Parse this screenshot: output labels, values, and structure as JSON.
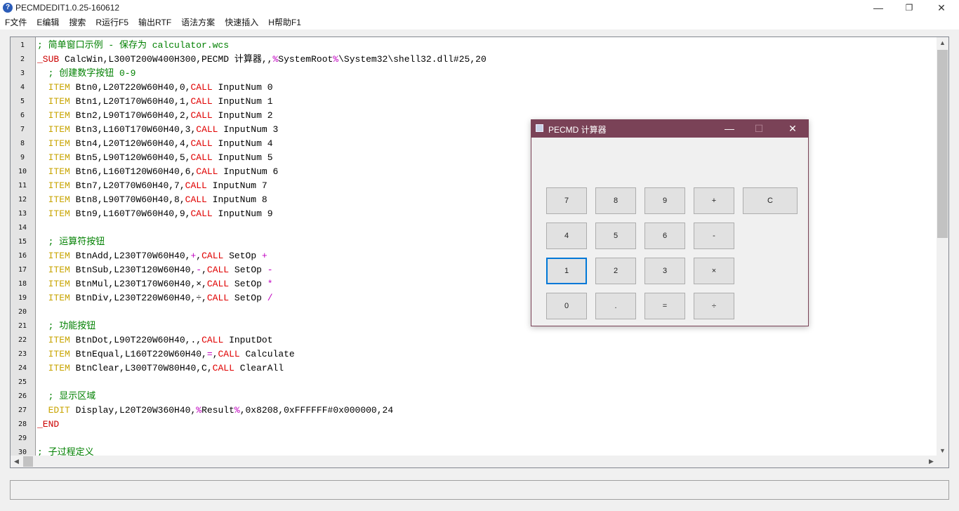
{
  "window": {
    "title": "PECMDEDIT1.0.25-160612",
    "minimize": "—",
    "restore": "❐",
    "close": "✕"
  },
  "menu": [
    "F文件",
    "E编辑",
    "搜索",
    "R运行F5",
    "输出RTF",
    "语法方案",
    "快速插入",
    "H帮助F1"
  ],
  "editor": {
    "line_numbers": [
      "1",
      "2",
      "3",
      "4",
      "5",
      "6",
      "7",
      "8",
      "9",
      "10",
      "11",
      "12",
      "13",
      "14",
      "15",
      "16",
      "17",
      "18",
      "19",
      "20",
      "21",
      "22",
      "23",
      "24",
      "25",
      "26",
      "27",
      "28",
      "29",
      "30"
    ],
    "lines": [
      [
        {
          "t": "; 简单窗口示例 - 保存为 calculator.wcs",
          "c": "cmt"
        }
      ],
      [
        {
          "t": "_SUB",
          "c": "sub"
        },
        {
          "t": " CalcWin,L300T200W400H300,PECMD 计算器,,"
        },
        {
          "t": "%",
          "c": "op"
        },
        {
          "t": "SystemRoot"
        },
        {
          "t": "%",
          "c": "op"
        },
        {
          "t": "\\System32\\shell32.dll#25,20"
        }
      ],
      [
        {
          "t": "  ; 创建数字按钮 0-9",
          "c": "cmt"
        }
      ],
      [
        {
          "t": "  "
        },
        {
          "t": "ITEM",
          "c": "kw"
        },
        {
          "t": " Btn0,L20T220W60H40,0,"
        },
        {
          "t": "CALL",
          "c": "call"
        },
        {
          "t": " InputNum 0"
        }
      ],
      [
        {
          "t": "  "
        },
        {
          "t": "ITEM",
          "c": "kw"
        },
        {
          "t": " Btn1,L20T170W60H40,1,"
        },
        {
          "t": "CALL",
          "c": "call"
        },
        {
          "t": " InputNum 1"
        }
      ],
      [
        {
          "t": "  "
        },
        {
          "t": "ITEM",
          "c": "kw"
        },
        {
          "t": " Btn2,L90T170W60H40,2,"
        },
        {
          "t": "CALL",
          "c": "call"
        },
        {
          "t": " InputNum 2"
        }
      ],
      [
        {
          "t": "  "
        },
        {
          "t": "ITEM",
          "c": "kw"
        },
        {
          "t": " Btn3,L160T170W60H40,3,"
        },
        {
          "t": "CALL",
          "c": "call"
        },
        {
          "t": " InputNum 3"
        }
      ],
      [
        {
          "t": "  "
        },
        {
          "t": "ITEM",
          "c": "kw"
        },
        {
          "t": " Btn4,L20T120W60H40,4,"
        },
        {
          "t": "CALL",
          "c": "call"
        },
        {
          "t": " InputNum 4"
        }
      ],
      [
        {
          "t": "  "
        },
        {
          "t": "ITEM",
          "c": "kw"
        },
        {
          "t": " Btn5,L90T120W60H40,5,"
        },
        {
          "t": "CALL",
          "c": "call"
        },
        {
          "t": " InputNum 5"
        }
      ],
      [
        {
          "t": "  "
        },
        {
          "t": "ITEM",
          "c": "kw"
        },
        {
          "t": " Btn6,L160T120W60H40,6,"
        },
        {
          "t": "CALL",
          "c": "call"
        },
        {
          "t": " InputNum 6"
        }
      ],
      [
        {
          "t": "  "
        },
        {
          "t": "ITEM",
          "c": "kw"
        },
        {
          "t": " Btn7,L20T70W60H40,7,"
        },
        {
          "t": "CALL",
          "c": "call"
        },
        {
          "t": " InputNum 7"
        }
      ],
      [
        {
          "t": "  "
        },
        {
          "t": "ITEM",
          "c": "kw"
        },
        {
          "t": " Btn8,L90T70W60H40,8,"
        },
        {
          "t": "CALL",
          "c": "call"
        },
        {
          "t": " InputNum 8"
        }
      ],
      [
        {
          "t": "  "
        },
        {
          "t": "ITEM",
          "c": "kw"
        },
        {
          "t": " Btn9,L160T70W60H40,9,"
        },
        {
          "t": "CALL",
          "c": "call"
        },
        {
          "t": " InputNum 9"
        }
      ],
      [],
      [
        {
          "t": "  ; 运算符按钮",
          "c": "cmt"
        }
      ],
      [
        {
          "t": "  "
        },
        {
          "t": "ITEM",
          "c": "kw"
        },
        {
          "t": " BtnAdd,L230T70W60H40,"
        },
        {
          "t": "+",
          "c": "op"
        },
        {
          "t": ","
        },
        {
          "t": "CALL",
          "c": "call"
        },
        {
          "t": " SetOp "
        },
        {
          "t": "+",
          "c": "op"
        }
      ],
      [
        {
          "t": "  "
        },
        {
          "t": "ITEM",
          "c": "kw"
        },
        {
          "t": " BtnSub,L230T120W60H40,"
        },
        {
          "t": "-",
          "c": "op"
        },
        {
          "t": ","
        },
        {
          "t": "CALL",
          "c": "call"
        },
        {
          "t": " SetOp "
        },
        {
          "t": "-",
          "c": "op"
        }
      ],
      [
        {
          "t": "  "
        },
        {
          "t": "ITEM",
          "c": "kw"
        },
        {
          "t": " BtnMul,L230T170W60H40,×,"
        },
        {
          "t": "CALL",
          "c": "call"
        },
        {
          "t": " SetOp "
        },
        {
          "t": "*",
          "c": "op"
        }
      ],
      [
        {
          "t": "  "
        },
        {
          "t": "ITEM",
          "c": "kw"
        },
        {
          "t": " BtnDiv,L230T220W60H40,÷,"
        },
        {
          "t": "CALL",
          "c": "call"
        },
        {
          "t": " SetOp "
        },
        {
          "t": "/",
          "c": "op"
        }
      ],
      [],
      [
        {
          "t": "  ; 功能按钮",
          "c": "cmt"
        }
      ],
      [
        {
          "t": "  "
        },
        {
          "t": "ITEM",
          "c": "kw"
        },
        {
          "t": " BtnDot,L90T220W60H40,.,"
        },
        {
          "t": "CALL",
          "c": "call"
        },
        {
          "t": " InputDot"
        }
      ],
      [
        {
          "t": "  "
        },
        {
          "t": "ITEM",
          "c": "kw"
        },
        {
          "t": " BtnEqual,L160T220W60H40,"
        },
        {
          "t": "=",
          "c": "op"
        },
        {
          "t": ","
        },
        {
          "t": "CALL",
          "c": "call"
        },
        {
          "t": " Calculate"
        }
      ],
      [
        {
          "t": "  "
        },
        {
          "t": "ITEM",
          "c": "kw"
        },
        {
          "t": " BtnClear,L300T70W80H40,C,"
        },
        {
          "t": "CALL",
          "c": "call"
        },
        {
          "t": " ClearAll"
        }
      ],
      [],
      [
        {
          "t": "  ; 显示区域",
          "c": "cmt"
        }
      ],
      [
        {
          "t": "  "
        },
        {
          "t": "EDIT",
          "c": "kw"
        },
        {
          "t": " Display,L20T20W360H40,"
        },
        {
          "t": "%",
          "c": "op"
        },
        {
          "t": "Result"
        },
        {
          "t": "%",
          "c": "op"
        },
        {
          "t": ",0x8208,0xFFFFFF#0x000000,24"
        }
      ],
      [
        {
          "t": "_END",
          "c": "sub"
        }
      ],
      [],
      [
        {
          "t": "; 子过程定义",
          "c": "cmt"
        }
      ]
    ],
    "scroll_up": "▲",
    "scroll_down": "▼",
    "scroll_left": "◀",
    "scroll_right": "▶"
  },
  "calculator": {
    "title": "PECMD 计算器",
    "minimize": "—",
    "maximize": "☐",
    "close": "✕",
    "display_value": "",
    "buttons": {
      "b7": "7",
      "b8": "8",
      "b9": "9",
      "add": "+",
      "clear": "C",
      "b4": "4",
      "b5": "5",
      "b6": "6",
      "sub": "-",
      "b1": "1",
      "b2": "2",
      "b3": "3",
      "mul": "×",
      "b0": "0",
      "dot": ".",
      "eq": "=",
      "div": "÷"
    }
  }
}
